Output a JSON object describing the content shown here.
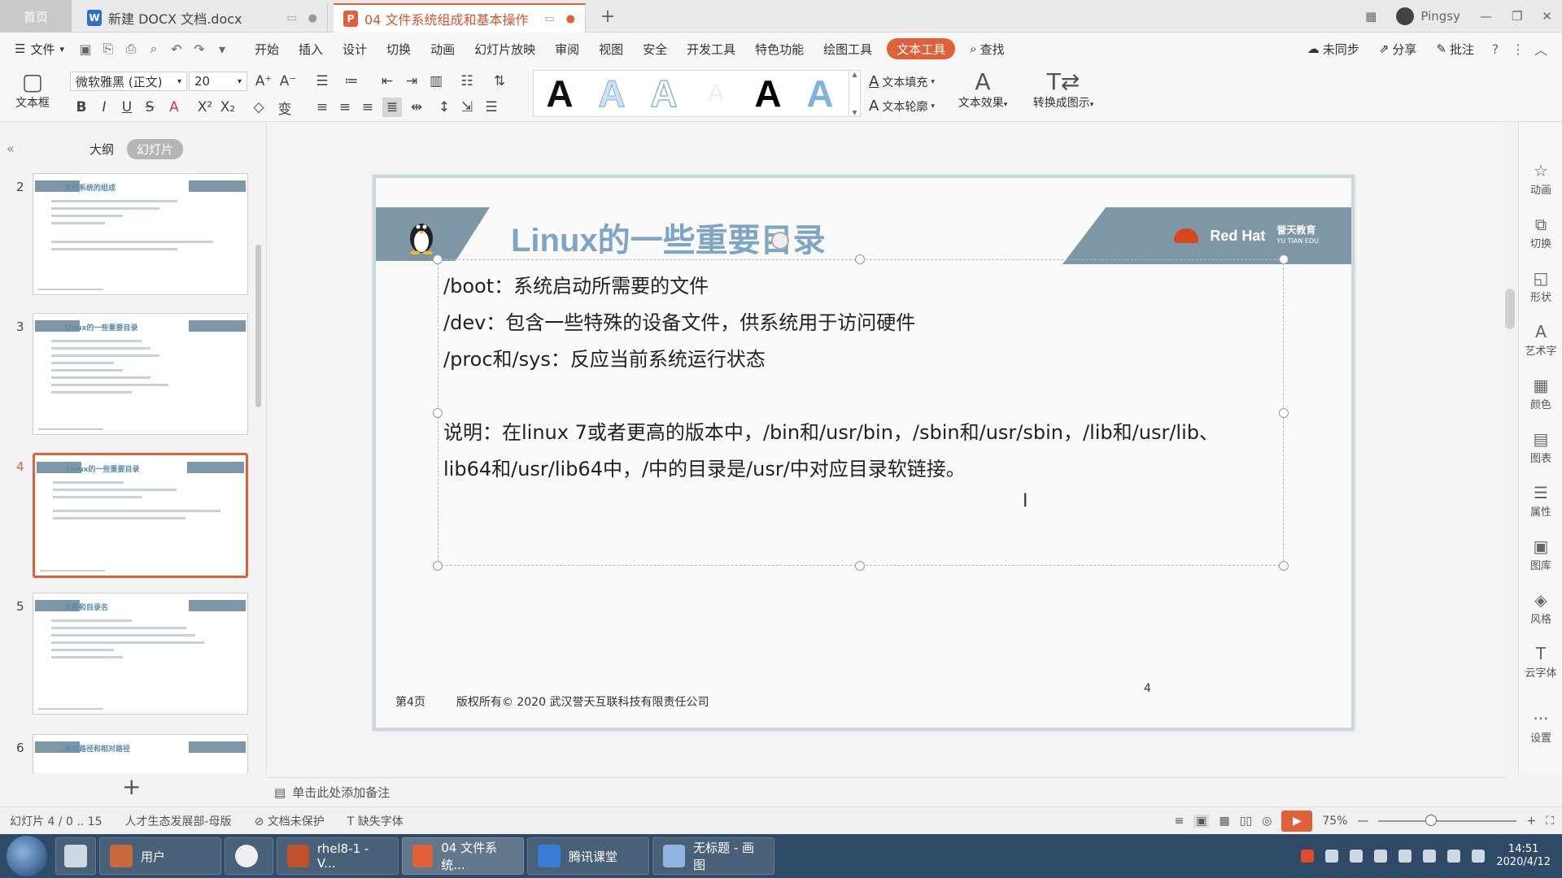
{
  "titlebar": {
    "home_label": "首页",
    "tabs": [
      {
        "label": "新建 DOCX 文档.docx",
        "icon_letter": "W"
      },
      {
        "label": "04 文件系统组成和基本操作",
        "icon_letter": "P"
      }
    ],
    "new_tab": "+",
    "user_name": "Pingsy"
  },
  "menubar": {
    "file_label": "文件",
    "items": [
      "开始",
      "插入",
      "设计",
      "切换",
      "动画",
      "幻灯片放映",
      "审阅",
      "视图",
      "安全",
      "开发工具",
      "特色功能",
      "绘图工具",
      "文本工具"
    ],
    "active_item": "文本工具",
    "search_label": "查找",
    "sync_label": "未同步",
    "share_label": "分享",
    "comment_label": "批注"
  },
  "ribbon": {
    "textbox_label": "文本框",
    "font_name": "微软雅黑 (正文)",
    "font_size": "20",
    "text_fill_label": "文本填充",
    "text_outline_label": "文本轮廓",
    "text_effect_label": "文本效果",
    "convert_label": "转换成图示",
    "style_samples": [
      "A",
      "A",
      "A",
      "A",
      "A",
      "A"
    ]
  },
  "leftpanel": {
    "outline_label": "大纲",
    "slides_label": "幻灯片",
    "thumbnails": [
      {
        "num": "2",
        "title": "文件系统的组成"
      },
      {
        "num": "3",
        "title": "Linux的一些重要目录"
      },
      {
        "num": "4",
        "title": "Linux的一些重要目录"
      },
      {
        "num": "5",
        "title": "文件和目录名"
      },
      {
        "num": "6",
        "title": "绝对路径和相对路径"
      }
    ],
    "add_slide": "+"
  },
  "slide": {
    "title": "Linux的一些重要目录",
    "logo_text": "Red Hat",
    "partner_logo": "誉天教育",
    "partner_logo_sub": "YU TIAN EDU",
    "lines": [
      "/boot：系统启动所需要的文件",
      "/dev：包含一些特殊的设备文件，供系统用于访问硬件",
      "/proc和/sys：反应当前系统运行状态",
      "",
      "说明：在linux 7或者更高的版本中，/bin和/usr/bin，/sbin和/usr/sbin，/lib和/usr/lib、",
      "lib64和/usr/lib64中，/中的目录是/usr/中对应目录软链接。"
    ],
    "footer_page": "第4页",
    "footer_copyright": "版权所有© 2020 武汉誉天互联科技有限责任公司",
    "slide_number": "4"
  },
  "notes": {
    "placeholder": "单击此处添加备注"
  },
  "rightpanel": {
    "items": [
      "动画",
      "切换",
      "形状",
      "艺术字",
      "颜色",
      "图表",
      "属性",
      "图库",
      "风格",
      "云字体",
      "设置"
    ]
  },
  "statusbar": {
    "slide_info": "幻灯片 4 / 0 .. 15",
    "template": "人才生态发展部-母版",
    "protect": "文档未保护",
    "missing_font": "缺失字体",
    "zoom": "75%"
  },
  "taskbar": {
    "buttons": [
      "用户",
      "",
      "rhel8-1 - V...",
      "04 文件系统...",
      "腾讯课堂",
      "无标题 - 画图"
    ],
    "time": "14:51",
    "date": "2020/4/12"
  },
  "colors": {
    "accent": "#e0603a",
    "banner": "#7e97a6",
    "title_blue": "#7ea6c3"
  }
}
